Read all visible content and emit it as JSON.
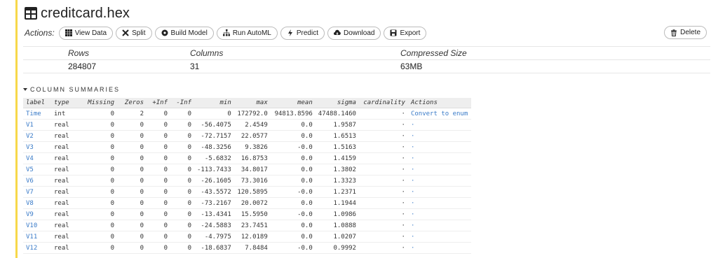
{
  "frame": {
    "title": "creditcard.hex"
  },
  "actions": {
    "label": "Actions:",
    "buttons": [
      {
        "label": "View Data",
        "icon": "table-icon"
      },
      {
        "label": "Split",
        "icon": "scissors-icon"
      },
      {
        "label": "Build Model",
        "icon": "cube-icon"
      },
      {
        "label": "Run AutoML",
        "icon": "sitemap-icon"
      },
      {
        "label": "Predict",
        "icon": "bolt-icon"
      },
      {
        "label": "Download",
        "icon": "cloud-download-icon"
      },
      {
        "label": "Export",
        "icon": "save-icon"
      }
    ],
    "delete_label": "Delete"
  },
  "summary": {
    "headers": [
      "Rows",
      "Columns",
      "Compressed Size"
    ],
    "values": [
      "284807",
      "31",
      "63MB"
    ]
  },
  "column_summaries": {
    "heading": "COLUMN SUMMARIES",
    "headers": [
      "label",
      "type",
      "Missing",
      "Zeros",
      "+Inf",
      "-Inf",
      "min",
      "max",
      "mean",
      "sigma",
      "cardinality",
      "Actions"
    ],
    "rows": [
      [
        "Time",
        "int",
        "0",
        "2",
        "0",
        "0",
        "0",
        "172792.0",
        "94813.8596",
        "47488.1460",
        "·",
        "Convert to enum"
      ],
      [
        "V1",
        "real",
        "0",
        "0",
        "0",
        "0",
        "-56.4075",
        "2.4549",
        "0.0",
        "1.9587",
        "·",
        "·"
      ],
      [
        "V2",
        "real",
        "0",
        "0",
        "0",
        "0",
        "-72.7157",
        "22.0577",
        "0.0",
        "1.6513",
        "·",
        "·"
      ],
      [
        "V3",
        "real",
        "0",
        "0",
        "0",
        "0",
        "-48.3256",
        "9.3826",
        "-0.0",
        "1.5163",
        "·",
        "·"
      ],
      [
        "V4",
        "real",
        "0",
        "0",
        "0",
        "0",
        "-5.6832",
        "16.8753",
        "0.0",
        "1.4159",
        "·",
        "·"
      ],
      [
        "V5",
        "real",
        "0",
        "0",
        "0",
        "0",
        "-113.7433",
        "34.8017",
        "0.0",
        "1.3802",
        "·",
        "·"
      ],
      [
        "V6",
        "real",
        "0",
        "0",
        "0",
        "0",
        "-26.1605",
        "73.3016",
        "0.0",
        "1.3323",
        "·",
        "·"
      ],
      [
        "V7",
        "real",
        "0",
        "0",
        "0",
        "0",
        "-43.5572",
        "120.5895",
        "-0.0",
        "1.2371",
        "·",
        "·"
      ],
      [
        "V8",
        "real",
        "0",
        "0",
        "0",
        "0",
        "-73.2167",
        "20.0072",
        "0.0",
        "1.1944",
        "·",
        "·"
      ],
      [
        "V9",
        "real",
        "0",
        "0",
        "0",
        "0",
        "-13.4341",
        "15.5950",
        "-0.0",
        "1.0986",
        "·",
        "·"
      ],
      [
        "V10",
        "real",
        "0",
        "0",
        "0",
        "0",
        "-24.5883",
        "23.7451",
        "0.0",
        "1.0888",
        "·",
        "·"
      ],
      [
        "V11",
        "real",
        "0",
        "0",
        "0",
        "0",
        "-4.7975",
        "12.0189",
        "0.0",
        "1.0207",
        "·",
        "·"
      ],
      [
        "V12",
        "real",
        "0",
        "0",
        "0",
        "0",
        "-18.6837",
        "7.8484",
        "-0.0",
        "0.9992",
        "·",
        "·"
      ]
    ]
  },
  "colors": {
    "accent_bar": "#f7d84a",
    "link": "#3a7bc8"
  }
}
